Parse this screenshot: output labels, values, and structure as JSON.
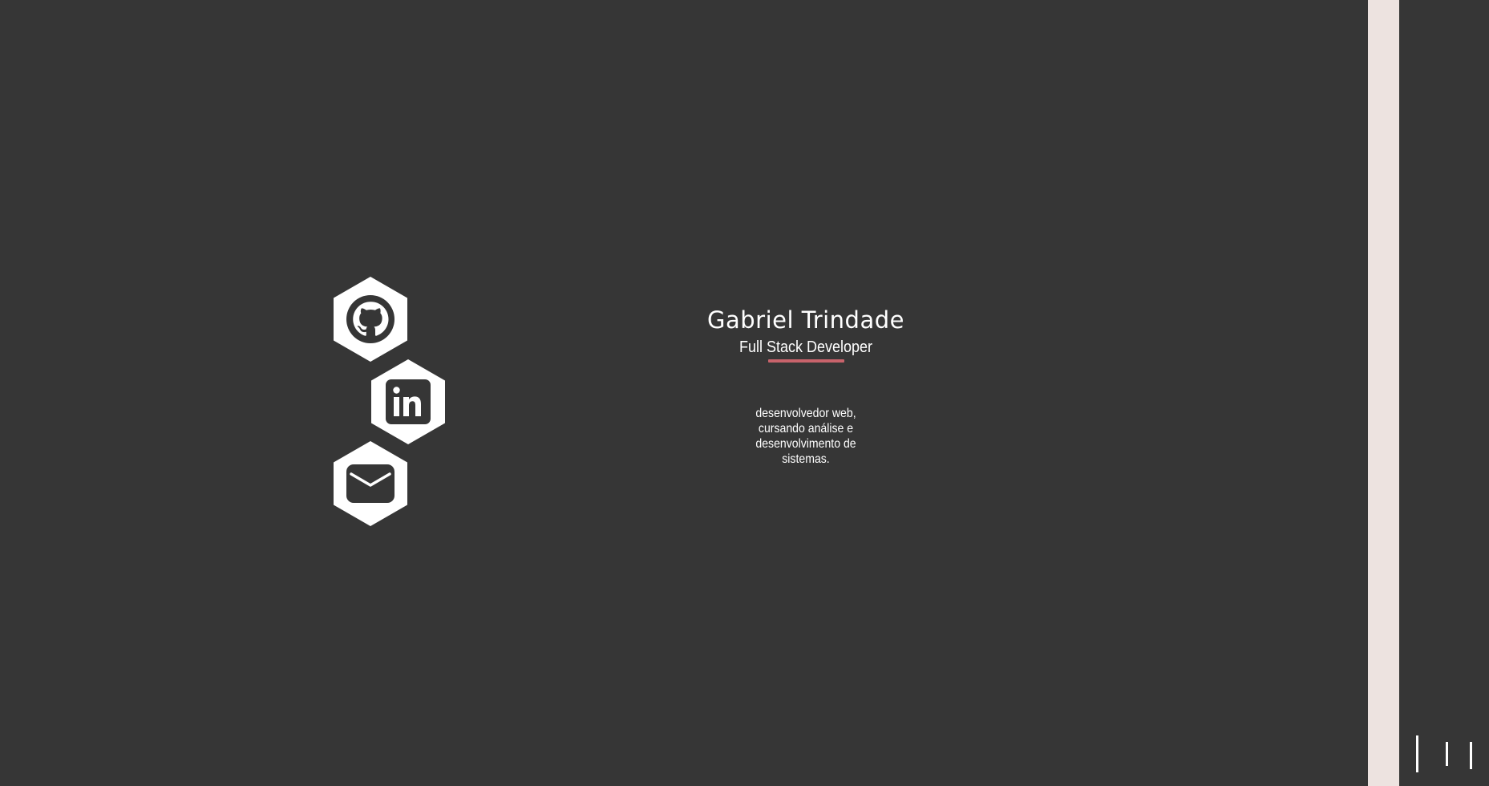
{
  "profile": {
    "name": "Gabriel Trindade",
    "role": "Full Stack Developer",
    "description": "desenvolvedor web, cursando análise e desenvolvimento de sistemas."
  },
  "social": [
    {
      "name": "github",
      "icon": "github-icon"
    },
    {
      "name": "linkedin",
      "icon": "linkedin-icon"
    },
    {
      "name": "email",
      "icon": "envelope-icon"
    }
  ],
  "colors": {
    "background": "#363636",
    "accent": "#c8636b",
    "side_strip": "#ede3e0",
    "foreground": "#ffffff"
  },
  "menu": {
    "icon": "menu-bars-icon"
  }
}
